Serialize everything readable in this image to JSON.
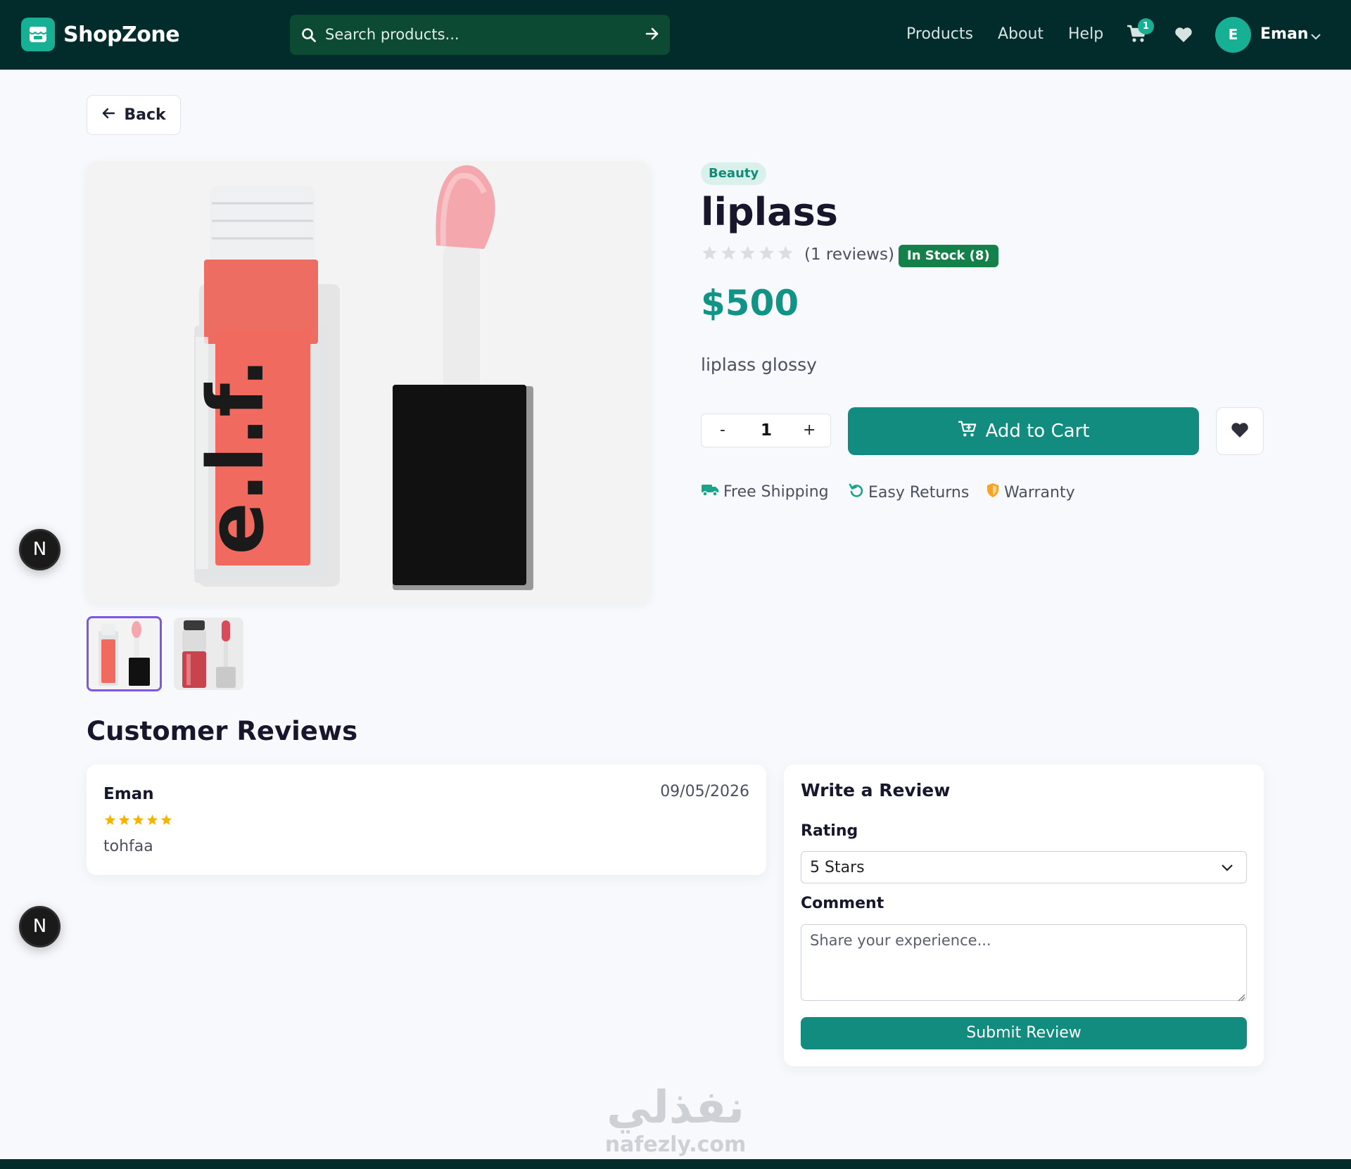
{
  "header": {
    "brand": "ShopZone",
    "search_placeholder": "Search products...",
    "nav": [
      "Products",
      "About",
      "Help"
    ],
    "cart_count": "1",
    "user_initial": "E",
    "user_name": "Eman"
  },
  "back_label": "Back",
  "product": {
    "category": "Beauty",
    "title": "liplass",
    "rating": 0,
    "reviews_text": "(1 reviews)",
    "stock_text": "In Stock (8)",
    "price": "$500",
    "description": "liplass glossy",
    "quantity": "1",
    "qty_minus": "-",
    "qty_plus": "+",
    "add_to_cart": "Add to Cart",
    "features": [
      "Free Shipping",
      "Easy Returns",
      "Warranty"
    ]
  },
  "reviews": {
    "heading": "Customer Reviews",
    "items": [
      {
        "author": "Eman",
        "date": "09/05/2026",
        "rating": 5,
        "text": "tohfaa"
      }
    ]
  },
  "review_form": {
    "title": "Write a Review",
    "rating_label": "Rating",
    "rating_value": "5 Stars",
    "comment_label": "Comment",
    "comment_placeholder": "Share your experience...",
    "submit_label": "Submit Review"
  },
  "floating_button_label": "N",
  "watermark": {
    "arabic": "نفذلي",
    "latin": "nafezly.com"
  },
  "colors": {
    "header_bg": "#022c2c",
    "accent": "#118c7e",
    "star_filled": "#f5b400",
    "stock_green": "#14804a"
  }
}
